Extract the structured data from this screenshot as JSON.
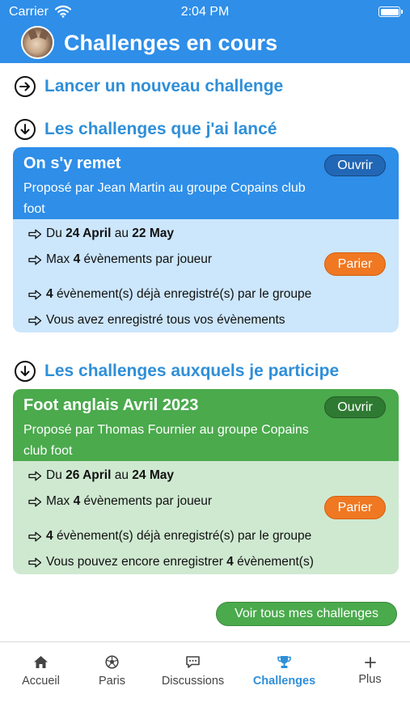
{
  "status_bar": {
    "carrier": "Carrier",
    "time": "2:04 PM",
    "icons": [
      "wifi-icon",
      "battery-icon"
    ]
  },
  "header": {
    "title": "Challenges en cours",
    "avatar": "cat-avatar"
  },
  "new_challenge_link": {
    "label": "Lancer un nouveau challenge",
    "icon": "arrow-right-circle-icon"
  },
  "launched_section": {
    "title": "Les challenges que j'ai lancé",
    "icon": "arrow-down-circle-icon",
    "card": {
      "name": "On s'y remet",
      "proposed_by": "Proposé par Jean Martin au groupe Copains club foot",
      "open_label": "Ouvrir",
      "bet_label": "Parier",
      "date_prefix": "Du",
      "date_start": "24 April",
      "date_mid": "au",
      "date_end": "22 May",
      "max_prefix": "Max",
      "max_value": "4",
      "max_suffix": "évènements par joueur",
      "recorded_value": "4",
      "recorded_suffix": "évènement(s) déjà enregistré(s) par le groupe",
      "user_status": "Vous avez enregistré tous vos évènements",
      "colors": {
        "header": "#2e8ee8",
        "body": "#cce6fc"
      }
    }
  },
  "participating_section": {
    "title": "Les challenges auxquels je participe",
    "icon": "arrow-down-circle-icon",
    "card": {
      "name": "Foot anglais Avril 2023",
      "proposed_by": "Proposé par Thomas Fournier au groupe Copains club foot",
      "open_label": "Ouvrir",
      "bet_label": "Parier",
      "date_prefix": "Du",
      "date_start": "26 April",
      "date_mid": "au",
      "date_end": "24 May",
      "max_prefix": "Max",
      "max_value": "4",
      "max_suffix": "évènements par joueur",
      "recorded_value": "4",
      "recorded_suffix": "évènement(s) déjà enregistré(s) par le groupe",
      "remaining_prefix": "Vous pouvez encore enregistrer",
      "remaining_value": "4",
      "remaining_suffix": "évènement(s)",
      "colors": {
        "header": "#4aaa4c",
        "body": "#cfe9d1"
      }
    }
  },
  "see_all_button": "Voir tous mes challenges",
  "tab_bar": {
    "active": "Challenges",
    "tabs": [
      {
        "label": "Accueil",
        "icon": "home-icon"
      },
      {
        "label": "Paris",
        "icon": "soccer-ball-icon"
      },
      {
        "label": "Discussions",
        "icon": "chat-bubble-icon"
      },
      {
        "label": "Challenges",
        "icon": "trophy-icon"
      },
      {
        "label": "Plus",
        "icon": "plus-icon"
      }
    ]
  },
  "colors": {
    "primary": "#2e8ee8",
    "link": "#2f8fd8",
    "success": "#4aaa4c",
    "bet_button": "#f07822"
  }
}
